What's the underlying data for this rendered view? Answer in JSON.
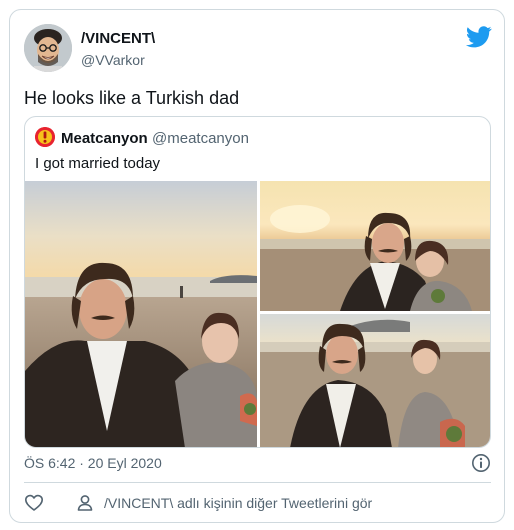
{
  "tweet": {
    "author": {
      "name": "/VINCENT\\",
      "handle": "@VVarkor"
    },
    "text": "He looks like a Turkish dad",
    "timestamp": "ÖS 6:42 · 20 Eyl 2020",
    "more_tweets_label": "/VINCENT\\ adlı kişinin diğer Tweetlerini gör"
  },
  "quoted": {
    "author": {
      "name": "Meatcanyon",
      "handle": "@meatcanyon"
    },
    "text": "I got married today",
    "photos": [
      "wedding-photo-beach-1",
      "wedding-photo-beach-2",
      "wedding-photo-beach-3"
    ]
  },
  "colors": {
    "brand_blue": "#1d9bf0",
    "text_primary": "#0f1419",
    "text_secondary": "#536471",
    "border": "#cfd9de"
  },
  "icons": [
    "twitter-bird-icon",
    "info-icon",
    "heart-icon",
    "person-icon"
  ]
}
